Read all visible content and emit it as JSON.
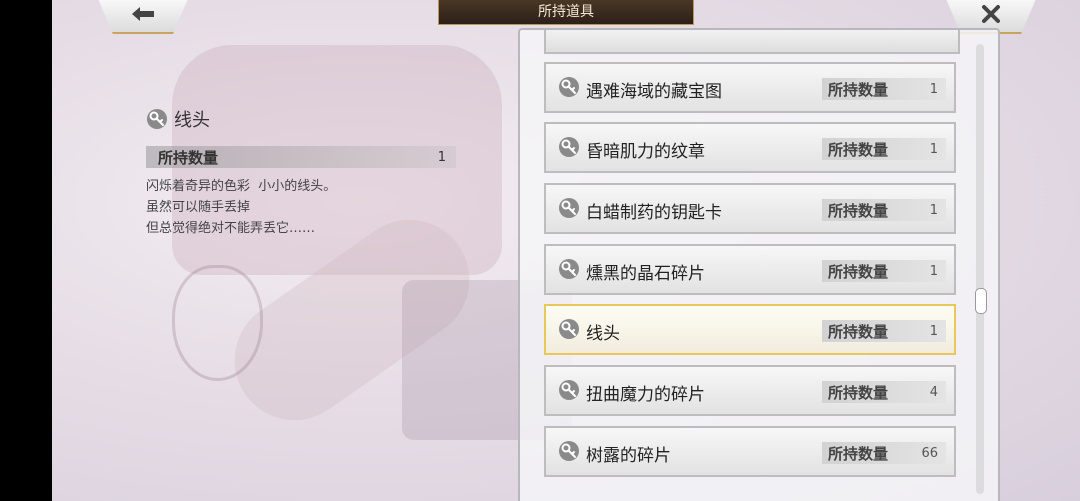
{
  "header": {
    "title": "所持道具"
  },
  "icons": {
    "back": "back-arrow-icon",
    "close": "close-x-icon",
    "item": "item-key-icon"
  },
  "detail": {
    "name": "线头",
    "qty_label": "所持数量",
    "qty_value": "1",
    "description": [
      "闪烁着奇异的色彩  小小的线头。",
      "虽然可以随手丢掉",
      "但总觉得绝对不能弄丢它……"
    ]
  },
  "list": {
    "qty_label": "所持数量",
    "items": [
      {
        "name": "遇难海域的藏宝图",
        "qty": "1",
        "selected": false
      },
      {
        "name": "昏暗肌力的纹章",
        "qty": "1",
        "selected": false
      },
      {
        "name": "白蜡制药的钥匙卡",
        "qty": "1",
        "selected": false
      },
      {
        "name": "燻黑的晶石碎片",
        "qty": "1",
        "selected": false
      },
      {
        "name": "线头",
        "qty": "1",
        "selected": true
      },
      {
        "name": "扭曲魔力的碎片",
        "qty": "4",
        "selected": false
      },
      {
        "name": "树露的碎片",
        "qty": "66",
        "selected": false
      }
    ]
  },
  "colors": {
    "selected_border": "#e7c85a",
    "title_bg": "#2c2018",
    "accent_gold": "#c9a45e"
  }
}
